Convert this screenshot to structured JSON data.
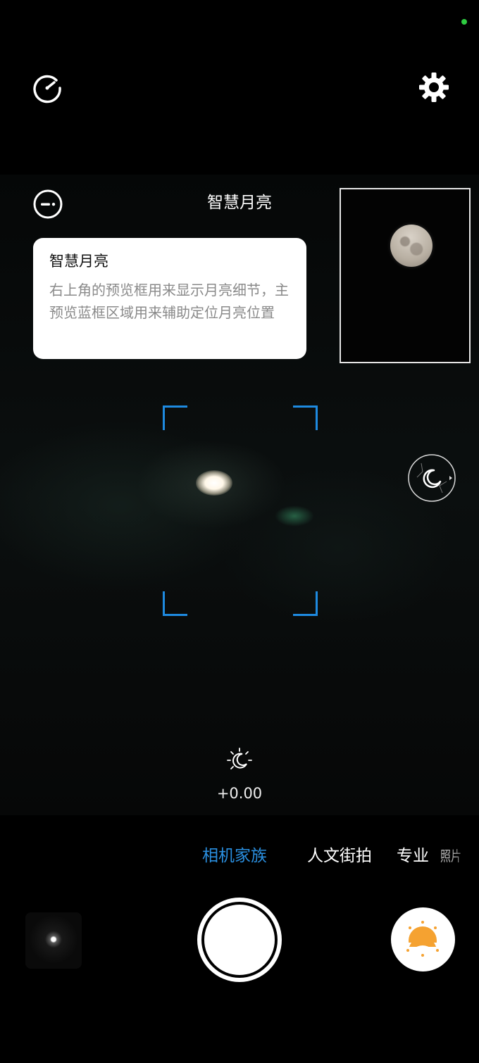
{
  "status": {
    "indicator_color": "#2ecc40"
  },
  "top_bar": {
    "left_icon": "speedometer-icon",
    "right_icon": "gear-icon"
  },
  "header": {
    "title": "智慧月亮",
    "left_icon": "dismiss-circle-icon"
  },
  "tooltip": {
    "title": "智慧月亮",
    "body": "右上角的预览框用来显示月亮细节，主预览蓝框区域用来辅助定位月亮位置"
  },
  "focus_frame": {
    "color": "#1e8ae0"
  },
  "night_toggle": {
    "icon": "moon-icon"
  },
  "exposure": {
    "icon": "sun-moon-icon",
    "value": "+0.00"
  },
  "modes": {
    "items": [
      {
        "label": "相机家族",
        "active": true
      },
      {
        "label": "人文街拍",
        "active": false
      },
      {
        "label": "专业",
        "active": false
      },
      {
        "label": "照片",
        "active": false
      }
    ],
    "active_color": "#2a8fe0"
  },
  "bottom_bar": {
    "gallery": "gallery-thumbnail",
    "shutter": "shutter-button",
    "filter_icon": "sunset-icon",
    "filter_color": "#f5a231"
  }
}
